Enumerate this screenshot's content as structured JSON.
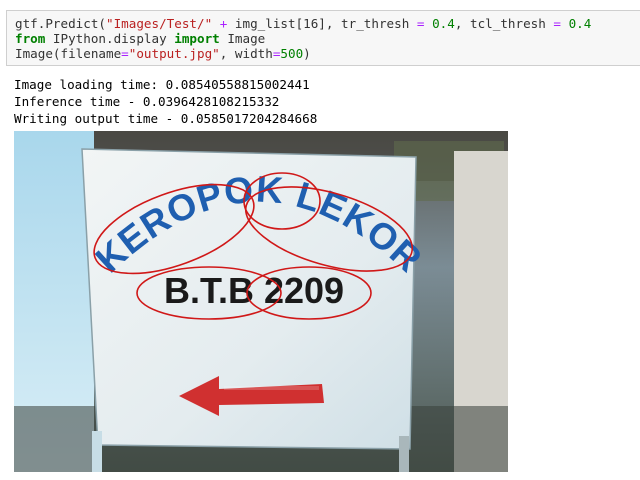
{
  "code": {
    "line1": {
      "call": "gtf.Predict(",
      "path": "\"Images/Test/\"",
      "plus": " + ",
      "imglist": "img_list[16], tr_thresh ",
      "eq1": "=",
      "num1": " 0.4",
      "comma": ", tcl_thresh ",
      "eq2": "=",
      "num2": " 0.4"
    },
    "line2": {
      "from_kw": "from",
      "module": " IPython.display ",
      "import_kw": "import",
      "name": " Image"
    },
    "line3": {
      "call": "Image(filename",
      "eq": "=",
      "filename": "\"output.jpg\"",
      "width_arg": ", width",
      "eq2": "=",
      "width_val": "500",
      "close": ")"
    }
  },
  "output": {
    "lines": [
      "Image loading time: 0.08540558815002441",
      "Inference time - 0.0396428108215332",
      "Writing output time - 0.0585017204284668"
    ]
  },
  "image": {
    "sign_line1": "KEROPOK LEKOR",
    "sign_line2": "B.T.B 2209"
  },
  "colors": {
    "sign_text": "#1f5fb0",
    "detection_ring": "#d01818",
    "arrow": "#d03030"
  }
}
